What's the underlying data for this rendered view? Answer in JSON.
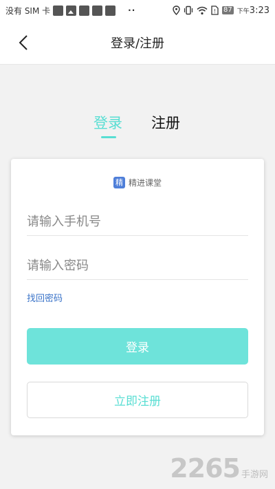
{
  "status_bar": {
    "carrier": "没有 SIM 卡",
    "dots": "··",
    "battery": "87",
    "time_prefix": "下午",
    "time": "3:23"
  },
  "header": {
    "title": "登录/注册"
  },
  "tabs": {
    "login": "登录",
    "register": "注册"
  },
  "brand": {
    "logo_char": "精",
    "name": "精进课堂"
  },
  "form": {
    "phone_placeholder": "请输入手机号",
    "phone_value": "",
    "password_placeholder": "请输入密码",
    "password_value": "",
    "forgot_label": "找回密码",
    "login_label": "登录",
    "register_label": "立即注册"
  },
  "watermark": {
    "number": "2265",
    "text": "手游网"
  },
  "colors": {
    "accent": "#58ded3",
    "button_fill": "#6ee3da",
    "link": "#3a73c8"
  }
}
